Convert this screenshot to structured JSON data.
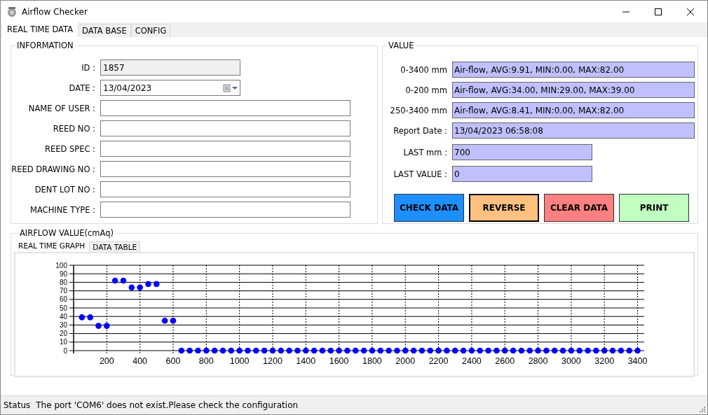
{
  "window": {
    "title": "Airflow Checker"
  },
  "tabs": [
    {
      "label": "REAL TIME DATA",
      "selected": true
    },
    {
      "label": "DATA BASE",
      "selected": false
    },
    {
      "label": "CONFIG",
      "selected": false
    }
  ],
  "information": {
    "title": "INFORMATION",
    "fields": [
      {
        "label": "ID :",
        "value": "1857",
        "kind": "readonly"
      },
      {
        "label": "DATE :",
        "value": "13/04/2023",
        "kind": "date"
      },
      {
        "label": "NAME OF USER :",
        "kind": "text"
      },
      {
        "label": "REED NO :",
        "kind": "text"
      },
      {
        "label": "REED SPEC :",
        "kind": "text"
      },
      {
        "label": "REED DRAWING NO :",
        "kind": "text"
      },
      {
        "label": "DENT LOT NO :",
        "kind": "text"
      },
      {
        "label": "MACHINE TYPE :",
        "kind": "text"
      }
    ]
  },
  "value": {
    "title": "VALUE",
    "rows": [
      {
        "label": "0-3400 mm",
        "value": "Air-flow, AVG:9.91, MIN:0.00, MAX:82.00",
        "kind": "wide"
      },
      {
        "label": "0-200 mm",
        "value": "Air-flow, AVG:34.00, MIN:29.00, MAX:39.00",
        "kind": "wide"
      },
      {
        "label": "250-3400 mm",
        "value": "Air-flow, AVG:8.41, MIN:0.00, MAX:82.00",
        "kind": "wide"
      },
      {
        "label": "Report Date  :",
        "value": "13/04/2023 06:58:08",
        "kind": "wide"
      },
      {
        "label": "LAST mm  :",
        "value": "700",
        "kind": "short"
      },
      {
        "label": "LAST VALUE  :",
        "value": "0",
        "kind": "short"
      }
    ],
    "buttons": [
      {
        "label": "CHECK DATA",
        "color": "#1e8fff",
        "focused": false
      },
      {
        "label": "REVERSE",
        "color": "#ffc080",
        "focused": true
      },
      {
        "label": "CLEAR DATA",
        "color": "#ff8080",
        "focused": false
      },
      {
        "label": "PRINT",
        "color": "#c0ffc0",
        "focused": false
      }
    ]
  },
  "airflow": {
    "title": "AIRFLOW VALUE(cmAq)",
    "tabs": [
      {
        "label": "REAL TIME GRAPH",
        "selected": true
      },
      {
        "label": "DATA TABLE",
        "selected": false
      }
    ],
    "chart_data": {
      "type": "scatter",
      "x": [
        50,
        100,
        150,
        200,
        250,
        300,
        350,
        400,
        450,
        500,
        550,
        600,
        650,
        700,
        750,
        800,
        850,
        900,
        950,
        1000,
        1050,
        1100,
        1150,
        1200,
        1250,
        1300,
        1350,
        1400,
        1450,
        1500,
        1550,
        1600,
        1650,
        1700,
        1750,
        1800,
        1850,
        1900,
        1950,
        2000,
        2050,
        2100,
        2150,
        2200,
        2250,
        2300,
        2350,
        2400,
        2450,
        2500,
        2550,
        2600,
        2650,
        2700,
        2750,
        2800,
        2850,
        2900,
        2950,
        3000,
        3050,
        3100,
        3150,
        3200,
        3250,
        3300,
        3350,
        3400
      ],
      "series": [
        {
          "color": "#0000ff",
          "values": [
            39,
            39,
            29,
            29,
            82,
            82,
            74,
            74,
            78,
            78,
            35,
            35,
            0,
            0,
            0,
            0,
            0,
            0,
            0,
            0,
            0,
            0,
            0,
            0,
            0,
            0,
            0,
            0,
            0,
            0,
            0,
            0,
            0,
            0,
            0,
            0,
            0,
            0,
            0,
            0,
            0,
            0,
            0,
            0,
            0,
            0,
            0,
            0,
            0,
            0,
            0,
            0,
            0,
            0,
            0,
            0,
            0,
            0,
            0,
            0,
            0,
            0,
            0,
            0,
            0,
            0,
            0,
            0
          ]
        }
      ],
      "grid": true,
      "xlim": [
        0,
        3440
      ],
      "ylim": [
        0,
        100
      ],
      "xticks": [
        200,
        400,
        600,
        800,
        1000,
        1200,
        1400,
        1600,
        1800,
        2000,
        2200,
        2400,
        2600,
        2800,
        3000,
        3200,
        3400
      ],
      "yticks": [
        0,
        10,
        20,
        30,
        40,
        50,
        60,
        70,
        80,
        90,
        100
      ]
    }
  },
  "status_bar": {
    "label": "Status",
    "message": "The port 'COM6' does not exist.Please check the configuration"
  }
}
